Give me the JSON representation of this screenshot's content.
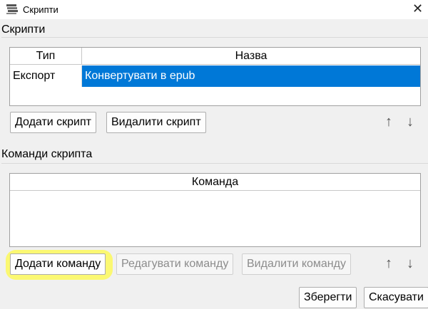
{
  "window": {
    "title": "Скрипти",
    "close_glyph": "✕"
  },
  "scripts": {
    "section_label": "Скрипти",
    "table": {
      "columns": [
        "Тип",
        "Назва"
      ],
      "rows": [
        {
          "type": "Експорт",
          "name": "Конвертувати в epub",
          "selected": true
        }
      ]
    },
    "add_label": "Додати скрипт",
    "remove_label": "Видалити скрипт",
    "up_glyph": "↑",
    "down_glyph": "↓"
  },
  "commands": {
    "section_label": "Команди скрипта",
    "table": {
      "columns": [
        "Команда"
      ],
      "rows": []
    },
    "add_label": "Додати команду",
    "edit_label": "Редагувати команду",
    "remove_label": "Видалити команду",
    "up_glyph": "↑",
    "down_glyph": "↓"
  },
  "footer": {
    "save_label": "Зберегти",
    "cancel_label": "Скасувати"
  },
  "colors": {
    "selection": "#0078d7",
    "highlight": "#fbf86a",
    "background": "#f0f0f0"
  }
}
